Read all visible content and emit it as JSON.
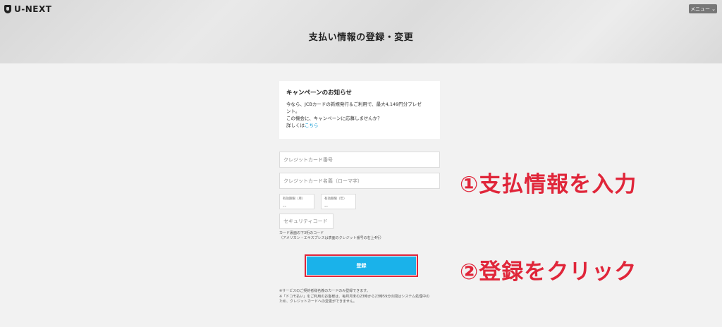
{
  "brand": {
    "logo_text": "U-NEXT",
    "logo_icon": "shield-logo-icon"
  },
  "header": {
    "menu_label": "メニュー",
    "menu_icon": "chevron-down-icon",
    "title": "支払い情報の登録・変更"
  },
  "campaign": {
    "heading": "キャンペーンのお知らせ",
    "line1": "今なら、JCBカードの新規発行＆ご利用で、最大4,149円分プレゼ",
    "line2": "ント。",
    "line3": "この機会に、キャンペーンに応募しませんか？",
    "details_prefix": "詳しくは",
    "details_link": "こちら"
  },
  "form": {
    "card_number_placeholder": "クレジットカード番号",
    "card_name_placeholder": "クレジットカード名義（ローマ字）",
    "exp_month_label": "有効期限（月）",
    "exp_month_value": "--",
    "exp_year_label": "有効期限（年）",
    "exp_year_value": "--",
    "security_placeholder": "セキュリティコード",
    "hint_line1": "カード裏面の下3桁のコード",
    "hint_line2": "（アメリカン・エキスプレスは表面のクレジット番号の右上4桁）",
    "submit_label": "登録"
  },
  "notes": {
    "line1": "※サービスのご契約者様名義のカードのみ登録できます。",
    "line2": "※「ドコモ払い」をご利用のお客様は、毎月月末の23時から23時59分の間はシステム処理中の",
    "line3": "ため、クレジットカードへの変更ができません。"
  },
  "annotations": {
    "step1": "①支払情報を入力",
    "step2": "②登録をクリック",
    "accent_color": "#e0263a"
  },
  "colors": {
    "button": "#1ab2ea",
    "link": "#1a9fd6",
    "background": "#f2f2f2"
  }
}
